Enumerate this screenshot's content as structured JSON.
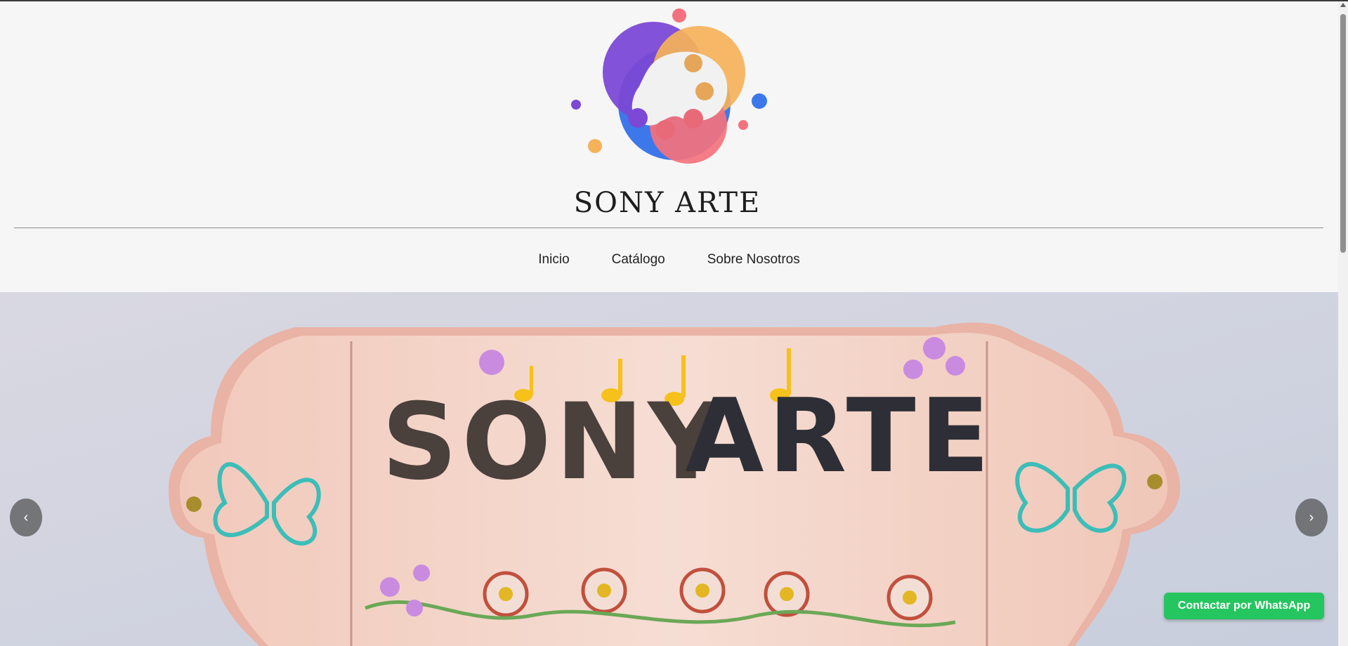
{
  "brand": {
    "name": "SONY ARTE"
  },
  "nav": {
    "items": [
      {
        "label": "Inicio"
      },
      {
        "label": "Catálogo"
      },
      {
        "label": "Sobre Nosotros"
      }
    ]
  },
  "carousel": {
    "prev_label": "‹",
    "next_label": "›",
    "slide_text": {
      "line1": "SONY",
      "line2": "ARTE"
    }
  },
  "whatsapp": {
    "label": "Contactar por WhatsApp",
    "color": "#25c55f"
  },
  "colors": {
    "purple": "#7b49d6",
    "blue": "#3d78ea",
    "orange": "#f5b259",
    "pink": "#f4727d"
  }
}
